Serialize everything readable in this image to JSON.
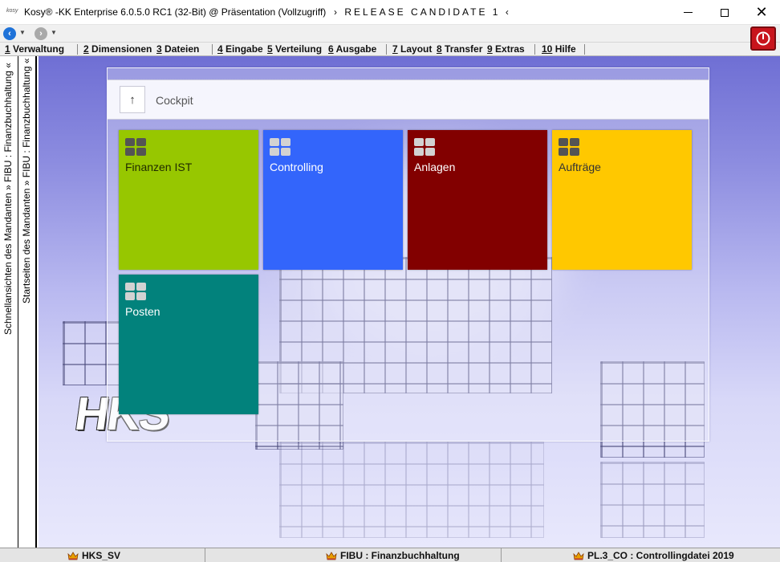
{
  "window": {
    "logo": "kosy",
    "title": "Kosy® -KK Enterprise 6.0.5.0 RC1 (32-Bit) @ Präsentation (Vollzugriff)",
    "release": "›  RELEASE CANDIDATE 1  ‹",
    "min_icon": "minimize-icon",
    "max_icon": "maximize-icon",
    "close_icon": "close-icon",
    "close_glyph": "✕"
  },
  "nav": {
    "back_glyph": "‹",
    "forward_glyph": "›",
    "dropdown_glyph": "▼",
    "power_icon": "power-icon"
  },
  "menu": [
    {
      "num": "1",
      "label": "Verwaltung"
    },
    {
      "num": "2",
      "label": "Dimensionen"
    },
    {
      "num": "3",
      "label": "Dateien"
    },
    {
      "num": "4",
      "label": "Eingabe"
    },
    {
      "num": "5",
      "label": "Verteilung"
    },
    {
      "num": "6",
      "label": "Ausgabe"
    },
    {
      "num": "7",
      "label": "Layout"
    },
    {
      "num": "8",
      "label": "Transfer"
    },
    {
      "num": "9",
      "label": "Extras"
    },
    {
      "num": "10",
      "label": "Hilfe"
    }
  ],
  "side_panels": {
    "panel1": "Schnellansichten des Mandanten » FIBU : Finanzbuchhaltung «",
    "panel2": "Startseiten des Mandanten » FIBU : Finanzbuchhaltung «"
  },
  "background": {
    "logo_text": "HKS"
  },
  "cockpit": {
    "up_glyph": "↑",
    "title": "Cockpit",
    "tiles": [
      {
        "label": "Finanzen IST",
        "color": "#97c700",
        "text_color": "#1f2a00",
        "icon_color": "#545454"
      },
      {
        "label": "Controlling",
        "color": "#3365fb",
        "text_color": "#ffffff",
        "icon_color": "#d2d2d2"
      },
      {
        "label": "Anlagen",
        "color": "#820000",
        "text_color": "#ffffff",
        "icon_color": "#d2d2d2"
      },
      {
        "label": "Aufträge",
        "color": "#ffc800",
        "text_color": "#333333",
        "icon_color": "#545454"
      },
      {
        "label": "Posten",
        "color": "#02827c",
        "text_color": "#ffffff",
        "icon_color": "#d2d2d2"
      }
    ]
  },
  "status": [
    {
      "text": "HKS_SV",
      "icon": "crown-icon"
    },
    {
      "text": "FIBU : Finanzbuchhaltung",
      "icon": "crown-icon"
    },
    {
      "text": "PL.3_CO : Controllingdatei 2019",
      "icon": "crown-icon"
    }
  ]
}
